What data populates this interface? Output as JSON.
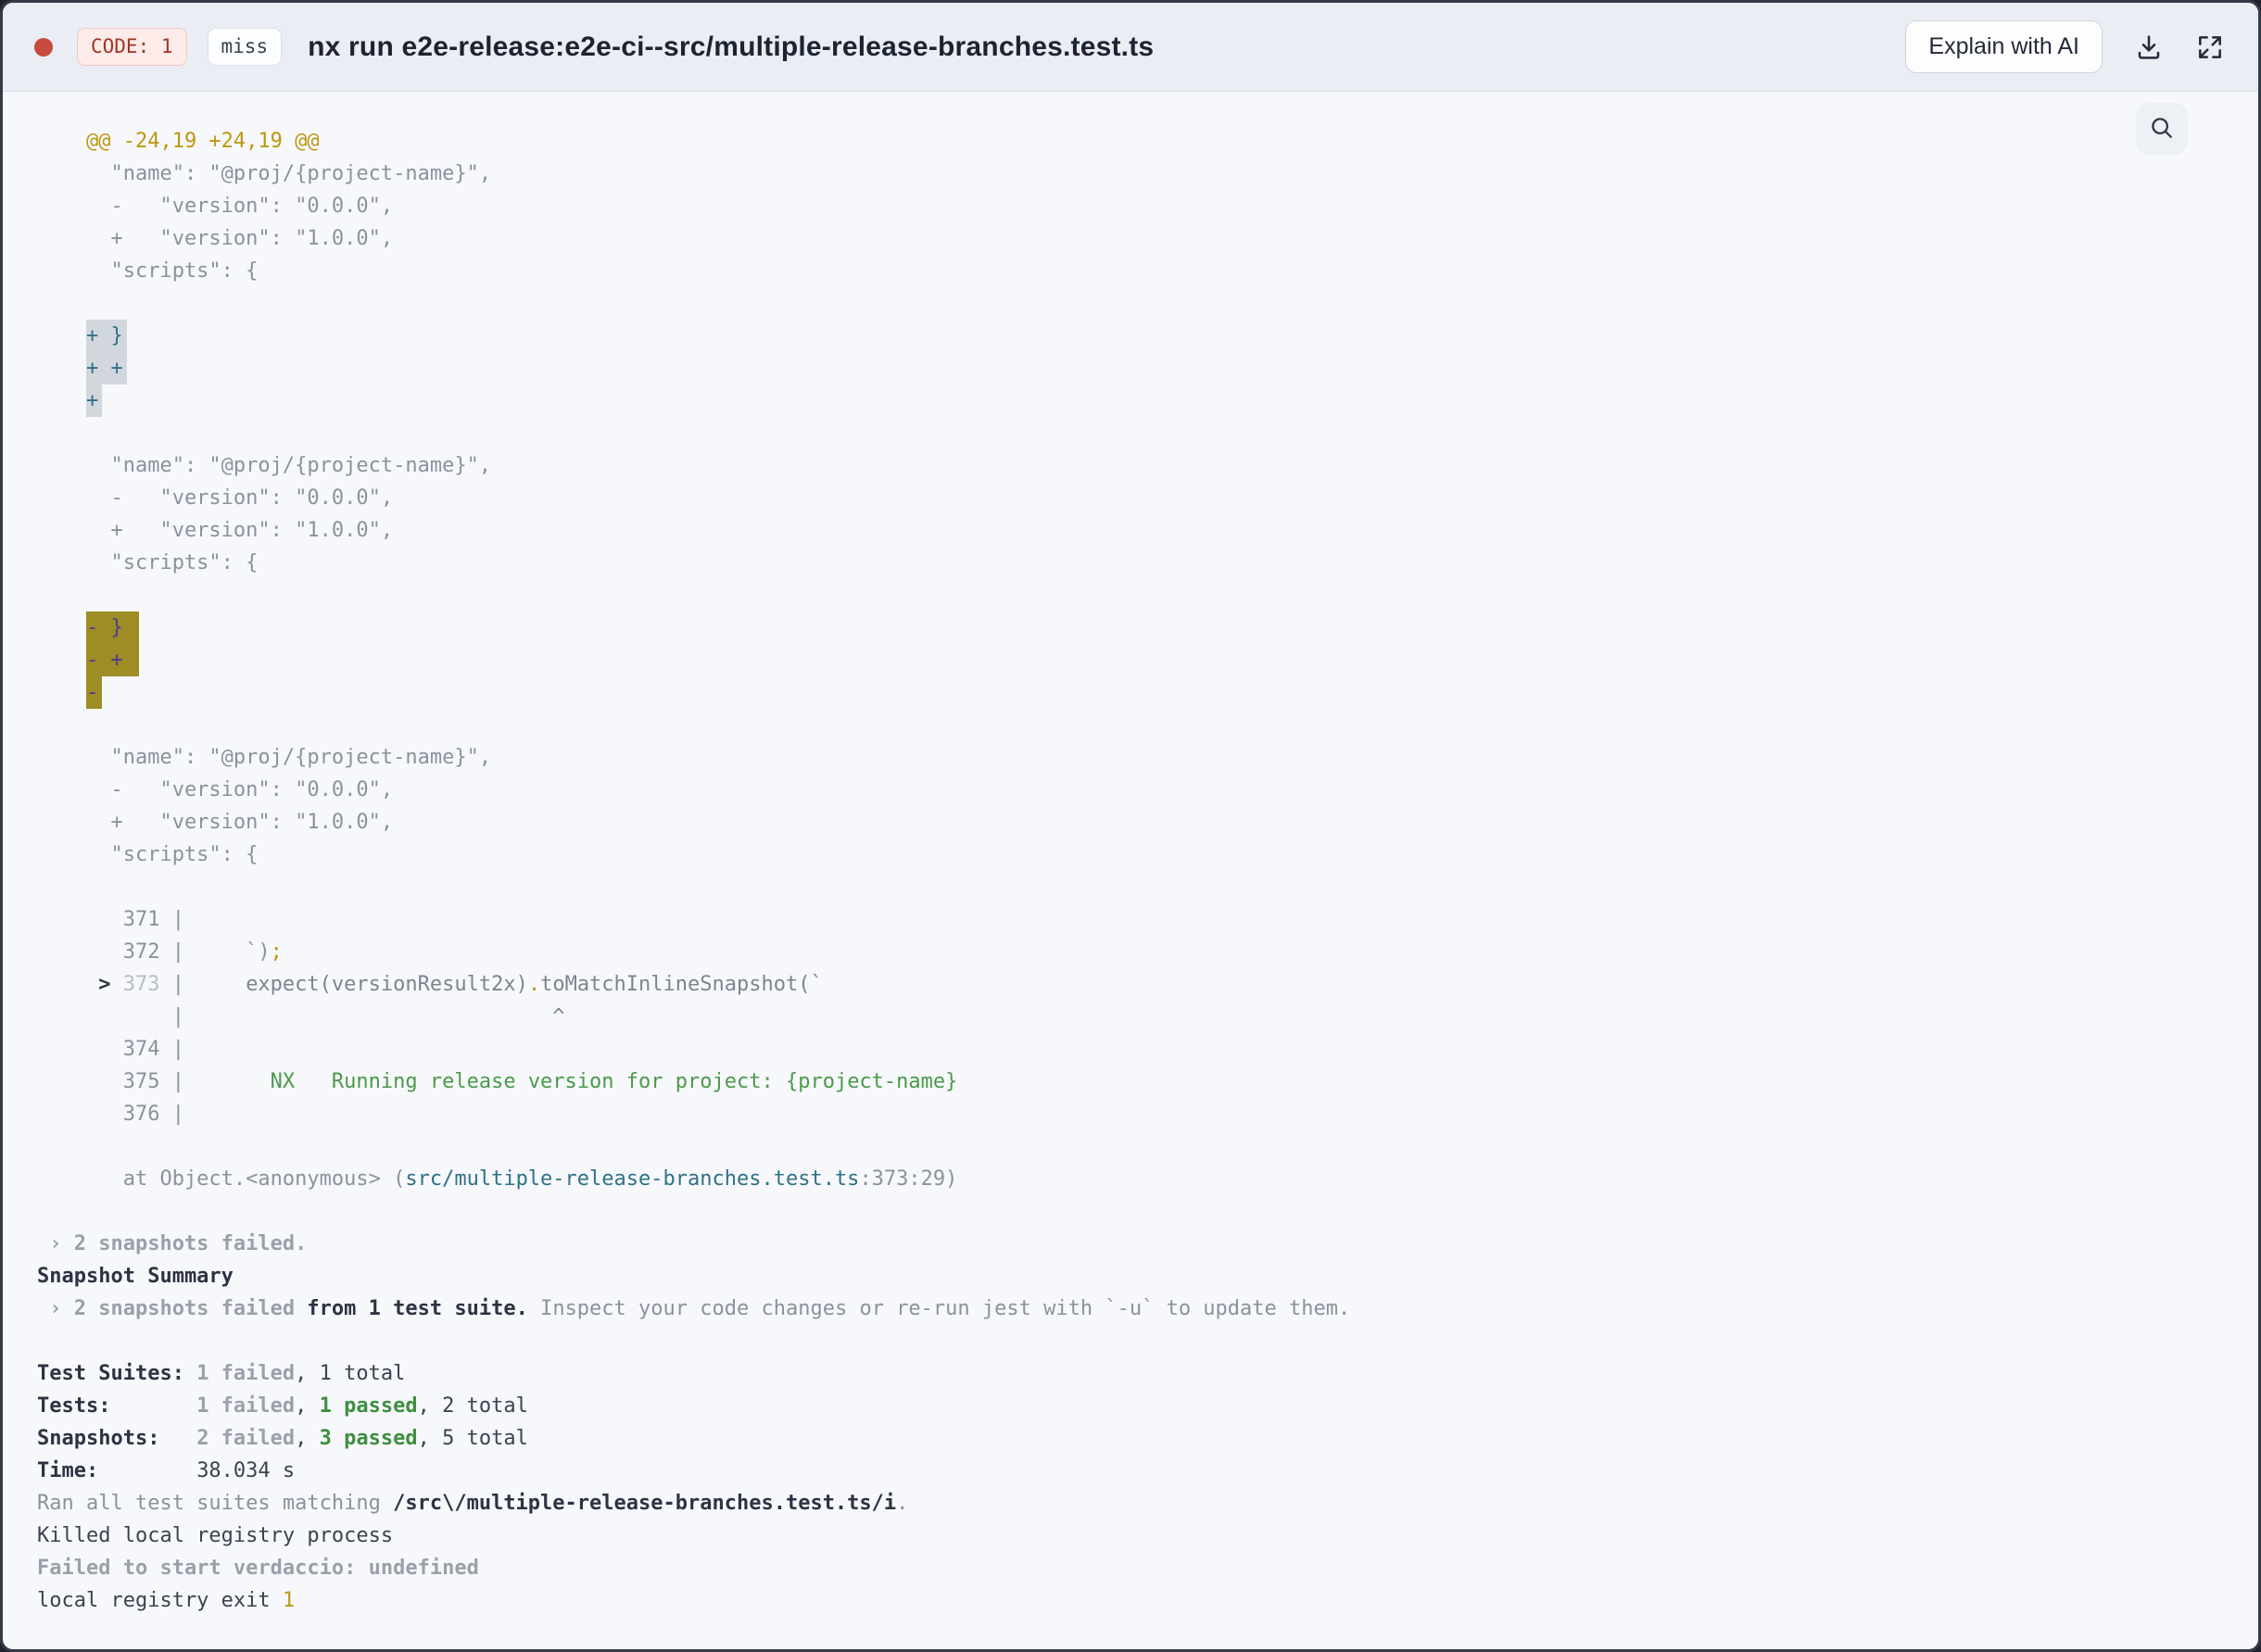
{
  "header": {
    "status_dot_color": "#c74b3e",
    "code_badge": "CODE: 1",
    "cache_badge": "miss",
    "title": "nx run e2e-release:e2e-ci--src/multiple-release-branches.test.ts",
    "explain_button": "Explain with AI",
    "download_icon": "download-icon",
    "fullscreen_icon": "fullscreen-icon"
  },
  "toolbar": {
    "search_icon": "magnifier-icon"
  },
  "colors": {
    "accent_gold": "#bd9712",
    "accent_green": "#4a9a4a",
    "accent_teal": "#2e7187",
    "diff_add_highlight": "#d2d7de",
    "diff_del_highlight": "#9e8c25",
    "header_bg": "#eaedf4",
    "terminal_bg": "#f7f8fb"
  },
  "terminal": {
    "lines": [
      [
        [
          "gold",
          "    @@ -24,19 +24,19 @@"
        ]
      ],
      [
        [
          "g",
          "      \"name\": \"@proj/{project-name}\","
        ]
      ],
      [
        [
          "g",
          "      -   \"version\": \"0.0.0\","
        ]
      ],
      [
        [
          "g",
          "      +   \"version\": \"1.0.0\","
        ]
      ],
      [
        [
          "g",
          "      \"scripts\": {"
        ]
      ],
      [],
      [
        [
          "g",
          "    "
        ],
        [
          "hladd",
          "+ }"
        ]
      ],
      [
        [
          "g",
          "    "
        ],
        [
          "hladd",
          "+ +"
        ]
      ],
      [
        [
          "g",
          "    "
        ],
        [
          "hladd",
          "+"
        ]
      ],
      [],
      [
        [
          "g",
          "      \"name\": \"@proj/{project-name}\","
        ]
      ],
      [
        [
          "g",
          "      -   \"version\": \"0.0.0\","
        ]
      ],
      [
        [
          "g",
          "      +   \"version\": \"1.0.0\","
        ]
      ],
      [
        [
          "g",
          "      \"scripts\": {"
        ]
      ],
      [],
      [
        [
          "g",
          "    "
        ],
        [
          "hldel",
          "- } "
        ]
      ],
      [
        [
          "g",
          "    "
        ],
        [
          "hldel",
          "- + "
        ]
      ],
      [
        [
          "g",
          "    "
        ],
        [
          "hldel",
          "-"
        ]
      ],
      [],
      [
        [
          "g",
          "      \"name\": \"@proj/{project-name}\","
        ]
      ],
      [
        [
          "g",
          "      -   \"version\": \"0.0.0\","
        ]
      ],
      [
        [
          "g",
          "      +   \"version\": \"1.0.0\","
        ]
      ],
      [
        [
          "g",
          "      \"scripts\": {"
        ]
      ],
      [],
      [
        [
          "g",
          "       371 |"
        ]
      ],
      [
        [
          "g",
          "       372 |     `)"
        ],
        [
          "gold",
          ";"
        ]
      ],
      [
        [
          "darkbold",
          "     > "
        ],
        [
          "dim",
          "373"
        ],
        [
          "g",
          " |     "
        ],
        [
          "code",
          "expect(versionResult2x)"
        ],
        [
          "gold",
          "."
        ],
        [
          "code",
          "toMatchInlineSnapshot(`"
        ]
      ],
      [
        [
          "g",
          "           |"
        ],
        [
          "code",
          "                              ^"
        ]
      ],
      [
        [
          "g",
          "       374 |"
        ]
      ],
      [
        [
          "g",
          "       375 |"
        ],
        [
          "green",
          "       NX   Running release version for project: {project-name}"
        ]
      ],
      [
        [
          "g",
          "       376 |"
        ]
      ],
      [],
      [
        [
          "g",
          "       at Object.<anonymous> ("
        ],
        [
          "teal",
          "src/multiple-release-branches.test.ts"
        ],
        [
          "g",
          ":373:29)"
        ]
      ],
      [],
      [
        [
          "graybold",
          " › 2 snapshots failed."
        ]
      ],
      [
        [
          "darkbold",
          "Snapshot Summary"
        ]
      ],
      [
        [
          "graybold",
          " › 2 snapshots failed"
        ],
        [
          "darkbold",
          " from 1 test suite."
        ],
        [
          "g",
          " Inspect your code changes or re-run jest with `-u` to update them."
        ]
      ],
      [],
      [
        [
          "darkbold",
          "Test Suites: "
        ],
        [
          "graybold",
          "1 failed"
        ],
        [
          "dark",
          ", 1 total"
        ]
      ],
      [
        [
          "darkbold",
          "Tests:       "
        ],
        [
          "graybold",
          "1 failed"
        ],
        [
          "dark",
          ", "
        ],
        [
          "greenbold",
          "1 passed"
        ],
        [
          "dark",
          ", 2 total"
        ]
      ],
      [
        [
          "darkbold",
          "Snapshots:   "
        ],
        [
          "graybold",
          "2 failed"
        ],
        [
          "dark",
          ", "
        ],
        [
          "greenbold",
          "3 passed"
        ],
        [
          "dark",
          ", 5 total"
        ]
      ],
      [
        [
          "darkbold",
          "Time:        "
        ],
        [
          "dark",
          "38.034 s"
        ]
      ],
      [
        [
          "g",
          "Ran all test suites matching "
        ],
        [
          "darkbold",
          "/src\\/multiple-release-branches.test.ts/i"
        ],
        [
          "g",
          "."
        ]
      ],
      [
        [
          "dark",
          "Killed local registry process"
        ]
      ],
      [
        [
          "graybold",
          "Failed to start verdaccio: undefined"
        ]
      ],
      [
        [
          "dark",
          "local registry exit "
        ],
        [
          "gold",
          "1"
        ]
      ]
    ]
  }
}
